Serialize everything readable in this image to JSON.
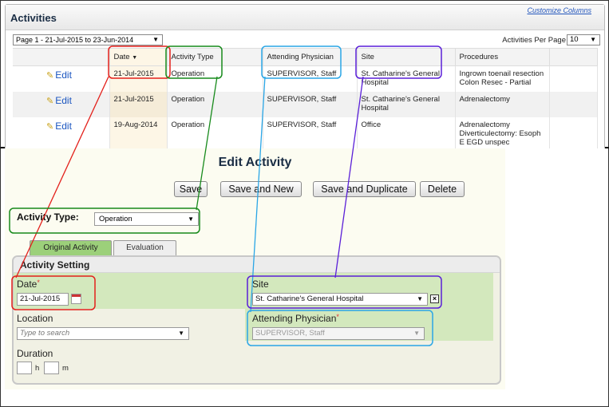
{
  "activities": {
    "title": "Activities",
    "customize_link": "Customize Columns",
    "pager": "Page 1 - 21-Jul-2015 to 23-Jun-2014",
    "per_page_label": "Activities Per Page",
    "per_page_value": "10",
    "columns": [
      "Date",
      "Activity Type",
      "Attending Physician",
      "Site",
      "Procedures"
    ],
    "sort_indicator": "▼",
    "rows": [
      {
        "edit": "Edit",
        "date": "21-Jul-2015",
        "type": "Operation",
        "physician": "SUPERVISOR, Staff",
        "site": "St. Catharine's General Hospital",
        "procedures": "Ingrown toenail resection\nColon Resec - Partial"
      },
      {
        "edit": "Edit",
        "date": "21-Jul-2015",
        "type": "Operation",
        "physician": "SUPERVISOR, Staff",
        "site": "St. Catharine's General Hospital",
        "procedures": "Adrenalectomy"
      },
      {
        "edit": "Edit",
        "date": "19-Aug-2014",
        "type": "Operation",
        "physician": "SUPERVISOR, Staff",
        "site": "Office",
        "procedures": "Adrenalectomy\nDiverticulectomy: Esoph\nE EGD unspec"
      }
    ]
  },
  "edit_activity": {
    "title": "Edit Activity",
    "buttons": {
      "save": "Save",
      "save_new": "Save and New",
      "save_duplicate": "Save and Duplicate",
      "delete": "Delete"
    },
    "activity_type_label": "Activity Type:",
    "activity_type_value": "Operation",
    "tabs": {
      "original": "Original Activity",
      "evaluation": "Evaluation"
    },
    "setting_title": "Activity Setting",
    "date_label": "Date",
    "date_value": "21-Jul-2015",
    "required_mark": "*",
    "site_label": "Site",
    "site_value": "St. Catharine's General Hospital",
    "location_label": "Location",
    "location_placeholder": "Type to search",
    "physician_label": "Attending Physician",
    "physician_value": "SUPERVISOR, Staff",
    "duration_label": "Duration",
    "hours_unit": "h",
    "minutes_unit": "m"
  },
  "colors": {
    "date": "#e3201b",
    "activity_type": "#178a1b",
    "physician": "#2aa6e6",
    "site": "#5a1fd8",
    "tab_active": "#9cd07a",
    "band": "#d3e8bd"
  }
}
